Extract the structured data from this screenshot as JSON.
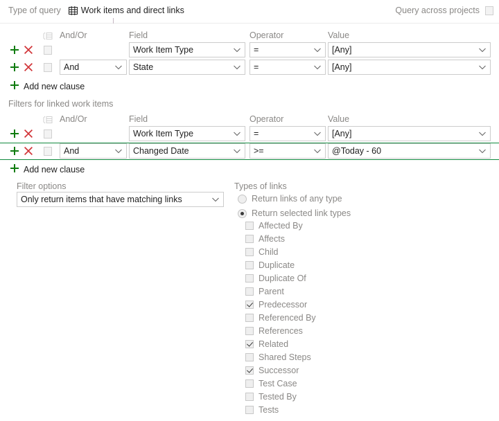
{
  "topbar": {
    "label": "Type of query",
    "type_icon": "grid-icon",
    "type_value": "Work items and direct links",
    "cross_projects_label": "Query across projects",
    "cross_projects_checked": false
  },
  "columns": {
    "andor": "And/Or",
    "field": "Field",
    "operator": "Operator",
    "value": "Value",
    "group_icon": "group-clauses-icon"
  },
  "icons": {
    "add": "add-clause-icon",
    "delete": "delete-clause-icon",
    "chevron": "chevron-down-icon"
  },
  "top_clauses": {
    "add_new_clause": "Add new clause",
    "rows": [
      {
        "andor": "",
        "field": "Work Item Type",
        "operator": "=",
        "value": "[Any]",
        "checked": false,
        "focused": false
      },
      {
        "andor": "And",
        "field": "State",
        "operator": "=",
        "value": "[Any]",
        "checked": false,
        "focused": false
      }
    ]
  },
  "linked_section": {
    "title": "Filters for linked work items",
    "add_new_clause": "Add new clause",
    "rows": [
      {
        "andor": "",
        "field": "Work Item Type",
        "operator": "=",
        "value": "[Any]",
        "checked": false,
        "focused": false
      },
      {
        "andor": "And",
        "field": "Changed Date",
        "operator": ">=",
        "value": "@Today - 60",
        "checked": false,
        "focused": true
      }
    ]
  },
  "filter_options": {
    "label": "Filter options",
    "selected": "Only return items that have matching links"
  },
  "types_of_links": {
    "title": "Types of links",
    "mode_options": [
      {
        "label": "Return links of any type",
        "selected": false
      },
      {
        "label": "Return selected link types",
        "selected": true
      }
    ],
    "link_types": [
      {
        "label": "Affected By",
        "checked": false
      },
      {
        "label": "Affects",
        "checked": false
      },
      {
        "label": "Child",
        "checked": false
      },
      {
        "label": "Duplicate",
        "checked": false
      },
      {
        "label": "Duplicate Of",
        "checked": false
      },
      {
        "label": "Parent",
        "checked": false
      },
      {
        "label": "Predecessor",
        "checked": true
      },
      {
        "label": "Referenced By",
        "checked": false
      },
      {
        "label": "References",
        "checked": false
      },
      {
        "label": "Related",
        "checked": true
      },
      {
        "label": "Shared Steps",
        "checked": false
      },
      {
        "label": "Successor",
        "checked": true
      },
      {
        "label": "Test Case",
        "checked": false
      },
      {
        "label": "Tested By",
        "checked": false
      },
      {
        "label": "Tests",
        "checked": false
      }
    ]
  },
  "colors": {
    "add_green": "#107c10",
    "delete_red": "#d13438",
    "focus_green": "#10893e",
    "muted": "#8a8886",
    "text": "#1f1f1f",
    "border": "#cccccc"
  }
}
